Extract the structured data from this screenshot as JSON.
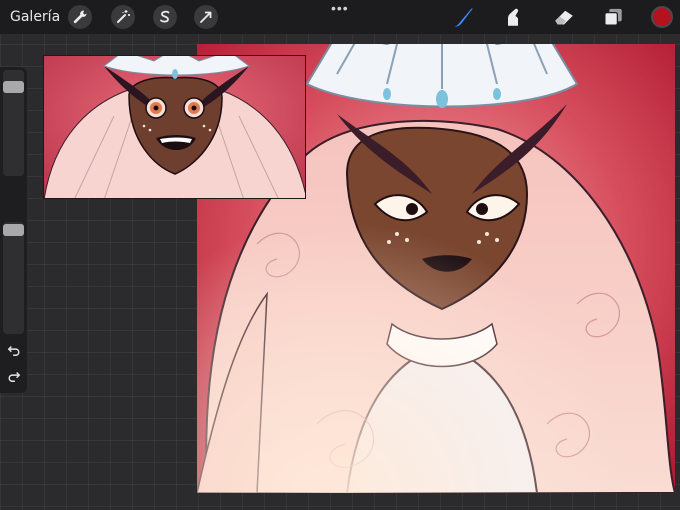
{
  "toolbar": {
    "gallery_label": "Galería",
    "actions": [
      {
        "name": "wrench-icon"
      },
      {
        "name": "magic-wand-icon"
      },
      {
        "name": "selection-s-icon"
      },
      {
        "name": "transform-arrow-icon"
      }
    ],
    "tools": [
      {
        "name": "brush-icon",
        "active": true
      },
      {
        "name": "smudge-icon",
        "active": false
      },
      {
        "name": "eraser-icon",
        "active": false
      },
      {
        "name": "layers-icon",
        "active": false
      }
    ],
    "current_color": "#b3121e",
    "accent_color": "#3b8bff"
  },
  "sidebar": {
    "brush_size": 0.88,
    "opacity": 0.98,
    "undo_icon": "undo-icon",
    "redo_icon": "redo-icon"
  }
}
